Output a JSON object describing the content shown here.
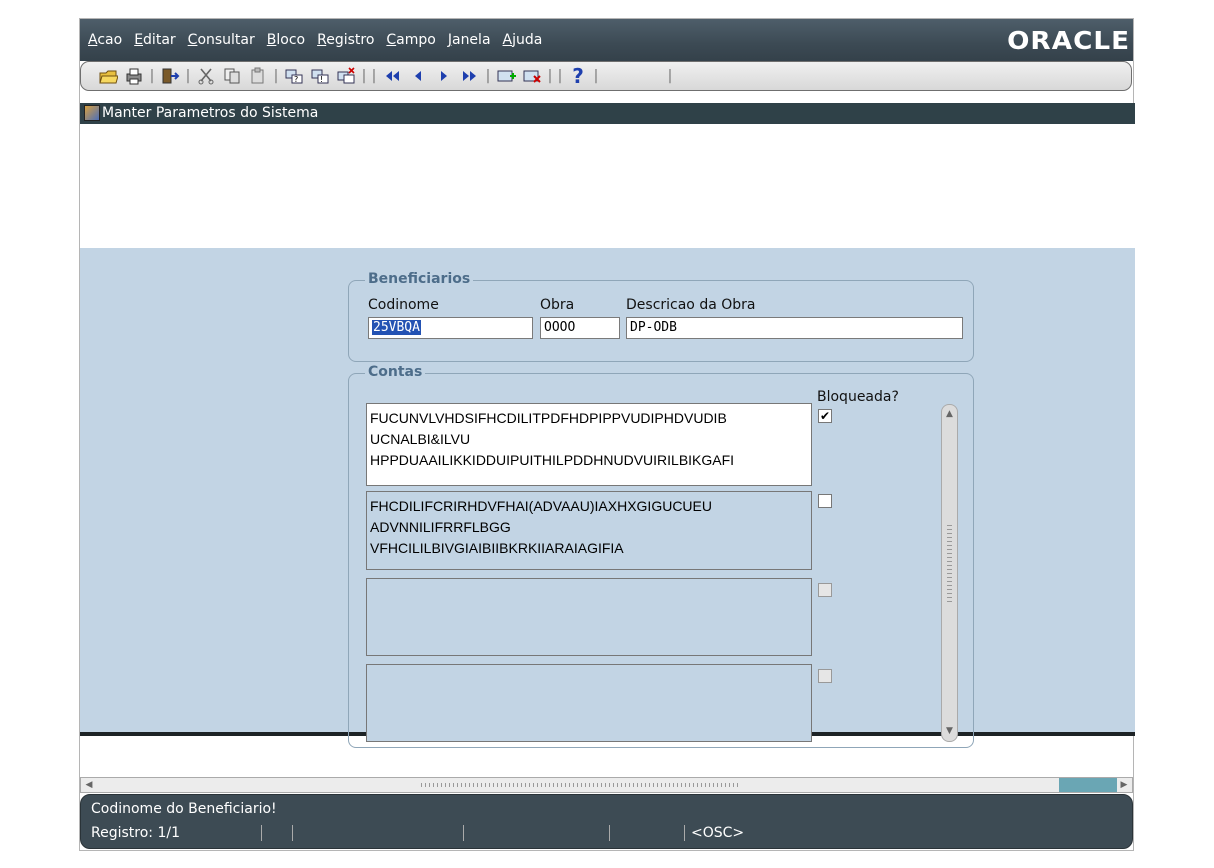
{
  "menu": [
    "Acao",
    "Editar",
    "Consultar",
    "Bloco",
    "Registro",
    "Campo",
    "Janela",
    "Ajuda"
  ],
  "brand": "ORACLE",
  "window_title": "Manter Parametros do Sistema",
  "beneficiarios": {
    "title": "Beneficiarios",
    "codinome_label": "Codinome",
    "codinome_value": "25VBQA",
    "obra_label": "Obra",
    "obra_value": "OOOO",
    "descricao_label": "Descricao da Obra",
    "descricao_value": "DP-ODB"
  },
  "contas": {
    "title": "Contas",
    "bloqueada_label": "Bloqueada?",
    "rows": [
      {
        "lines": [
          "FUCUNVLVHDSIFHCDILITPDFHDPIPPVUDIPHDVUDIB",
          "UCNALBI&ILVU",
          "HPPDUAAILIKKIDDUIPUITHILPDDHNUDVUIRILBIKGAFI"
        ],
        "checked": "✔"
      },
      {
        "lines": [
          "FHCDILIFCRIRHDVFHAI(ADVAAU)IAXHXGIGUCUEU",
          "ADVNNILIFRRFLBGG",
          "VFHCILILBIVGIAIBIIBKRKIIARAIAGIFIA"
        ],
        "checked": ""
      },
      {
        "lines": [],
        "checked": ""
      },
      {
        "lines": [],
        "checked": ""
      }
    ]
  },
  "status": {
    "message": "Codinome do Beneficiario!",
    "registro": "Registro: 1/1",
    "mode": "<OSC>"
  },
  "icons": [
    "open-folder-icon",
    "print-icon",
    "exit-icon",
    "cut-icon",
    "copy-icon",
    "paste-icon",
    "enter-query-icon",
    "execute-query-icon",
    "cancel-query-icon",
    "first-record-icon",
    "previous-record-icon",
    "next-record-icon",
    "last-record-icon",
    "insert-record-icon",
    "delete-record-icon",
    "help-icon"
  ]
}
